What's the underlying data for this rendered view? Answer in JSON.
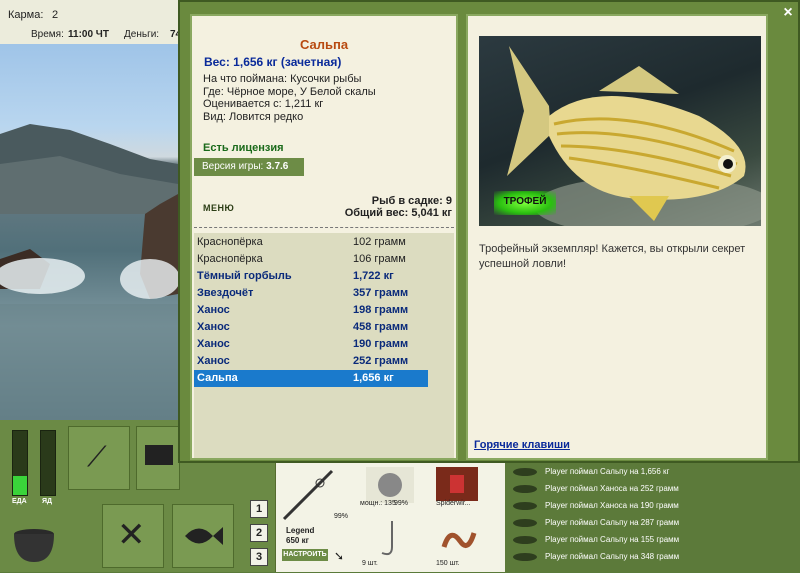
{
  "topbar": {
    "karma_label": "Карма:",
    "karma_value": "2",
    "time_label": "Время:",
    "time_value": "11:00 ЧТ",
    "money_label": "Деньги:",
    "money_value": "74"
  },
  "left_meters": {
    "food_label": "ЕДА",
    "poison_label": "ЯД",
    "food_level": 0.3,
    "poison_level": 0.0
  },
  "page_buttons": [
    "1",
    "2",
    "3"
  ],
  "inventory": {
    "rod_name": "Legend",
    "rod_weight": "650 кг",
    "rod_percent": "99%",
    "setup_button": "НАСТРОИТЬ",
    "reel_label": "мощн.: 135",
    "reel_percent": "99%",
    "line_label": "Spiderwir...",
    "hook_count": "9 шт.",
    "bait_count": "150 шт."
  },
  "log": {
    "entries": [
      "Player поймал Сальпу на 1,656 кг",
      "Player поймал Ханоса на 252 грамм",
      "Player поймал Ханоса на 190 грамм",
      "Player поймал Сальпу на 287 грамм",
      "Player поймал Сальпу на 155 грамм",
      "Player поймал Сальпу на 348 грамм"
    ]
  },
  "dialog": {
    "fish_title": "Сальпа",
    "weight_line": "Вес: 1,656 кг (зачетная)",
    "caught_on": "На что поймана: Кусочки рыбы",
    "where": "Где: Чёрное море, У Белой скалы",
    "valued": "Оценивается с: 1,211 кг",
    "kind": "Вид: Ловится редко",
    "license": "Есть лицензия",
    "version_label": "Версия игры:",
    "version_value": "3.7.6",
    "menu_label": "МЕНЮ",
    "keepnet_count": "Рыб в садке: 9",
    "keepnet_weight": "Общий вес: 5,041 кг",
    "trophy_badge": "ТРОФЕЙ",
    "trophy_text": "Трофейный экземпляр! Кажется, вы открыли секрет успешной ловли!",
    "hotkeys": "Горячие клавиши",
    "close": "×"
  },
  "catch_list": [
    {
      "name": "Краснопёрка",
      "weight": "102 грамм",
      "style": "normal"
    },
    {
      "name": "Краснопёрка",
      "weight": "106 грамм",
      "style": "normal"
    },
    {
      "name": "Тёмный горбыль",
      "weight": "1,722 кг",
      "style": "bold"
    },
    {
      "name": "Звездочёт",
      "weight": "357 грамм",
      "style": "bold"
    },
    {
      "name": "Ханос",
      "weight": "198 грамм",
      "style": "bold"
    },
    {
      "name": "Ханос",
      "weight": "458 грамм",
      "style": "bold"
    },
    {
      "name": "Ханос",
      "weight": "190 грамм",
      "style": "bold"
    },
    {
      "name": "Ханос",
      "weight": "252 грамм",
      "style": "bold"
    },
    {
      "name": "Сальпа",
      "weight": "1,656 кг",
      "style": "sel"
    }
  ],
  "colors": {
    "accent_green": "#6a8a3e",
    "selection_blue": "#1a7acc",
    "title_orange": "#b84a10"
  }
}
